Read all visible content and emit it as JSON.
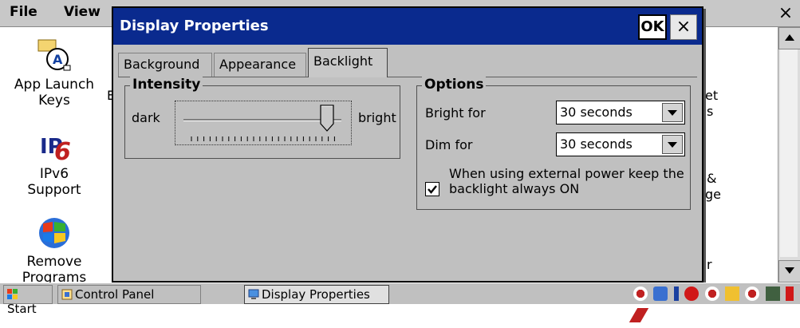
{
  "menubar": {
    "file": "File",
    "view": "View",
    "close": "×"
  },
  "desktop": {
    "items": [
      {
        "label_line1": "App Launch",
        "label_line2": "Keys",
        "icon": "app-launch-keys-icon"
      },
      {
        "label_line1": "IPv6",
        "label_line2": "Support",
        "icon": "ipv6-icon"
      },
      {
        "label_line1": "Remove",
        "label_line2": "Programs",
        "icon": "remove-programs-icon"
      }
    ],
    "peek_left": "E",
    "peek_right": [
      "et",
      "s",
      "&",
      "ge",
      "r"
    ]
  },
  "dialog": {
    "title": "Display Properties",
    "ok_label": "OK",
    "close_label": "×",
    "tabs": [
      {
        "label": "Background"
      },
      {
        "label": "Appearance"
      },
      {
        "label": "Backlight"
      }
    ],
    "intensity": {
      "legend": "Intensity",
      "dark_label": "dark",
      "bright_label": "bright",
      "level": 0.95
    },
    "options": {
      "legend": "Options",
      "bright_for_label": "Bright for",
      "bright_for_value": "30 seconds",
      "dim_for_label": "Dim for",
      "dim_for_value": "30 seconds",
      "external_power_label": "When using external power keep the backlight always ON",
      "external_power_checked": true
    }
  },
  "taskbar": {
    "start": "Start",
    "control_panel": "Control Panel",
    "display_properties": "Display Properties"
  }
}
